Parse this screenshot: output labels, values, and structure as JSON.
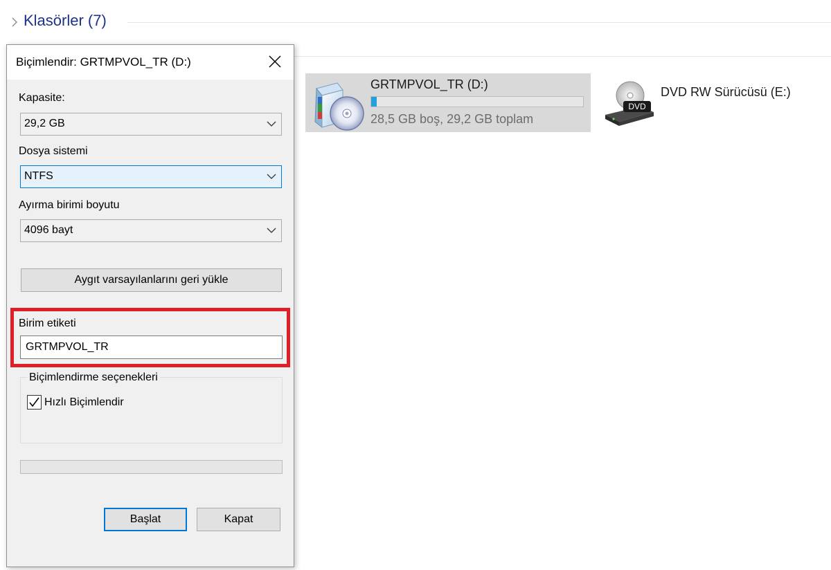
{
  "explorer": {
    "section_title": "Klasörler (7)",
    "drives": [
      {
        "name": "GRTMPVOL_TR (D:)",
        "free_text": "28,5 GB boş, 29,2 GB toplam",
        "used_fraction": 0.027,
        "bar_color": "#26a0da"
      },
      {
        "name": "DVD RW Sürücüsü (E:)",
        "icon_badge": "DVD"
      }
    ]
  },
  "dialog": {
    "title": "Biçimlendir: GRTMPVOL_TR (D:)",
    "capacity": {
      "label": "Kapasite:",
      "value": "29,2 GB"
    },
    "filesystem": {
      "label": "Dosya sistemi",
      "value": "NTFS"
    },
    "allocation": {
      "label": "Ayırma birimi boyutu",
      "value": "4096 bayt"
    },
    "restore_defaults_label": "Aygıt varsayılanlarını geri yükle",
    "volume_label": {
      "label": "Birim etiketi",
      "value": "GRTMPVOL_TR"
    },
    "format_options": {
      "legend": "Biçimlendirme seçenekleri",
      "quick_format_label": "Hızlı Biçimlendir",
      "quick_format_checked": true
    },
    "progress_fraction": 0,
    "start_label": "Başlat",
    "close_label": "Kapat",
    "highlight_color": "#e01e25",
    "accent_color": "#0078d7"
  }
}
